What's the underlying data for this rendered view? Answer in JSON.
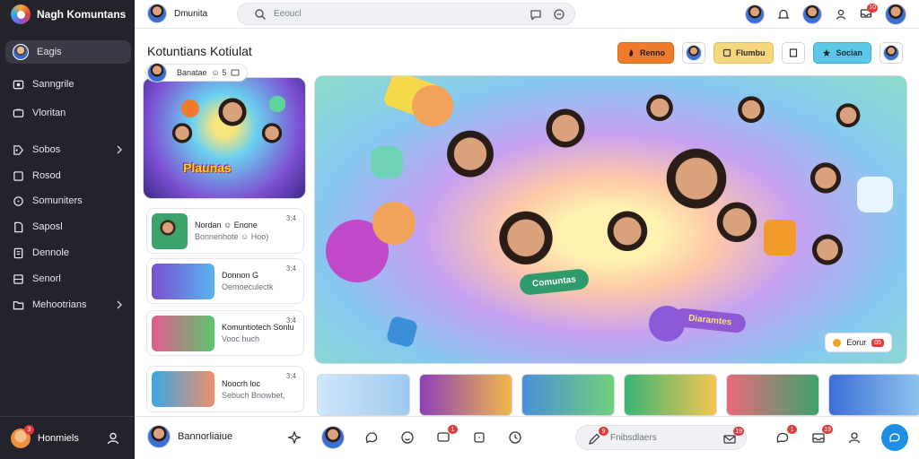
{
  "sidebar": {
    "brand": "Nagh Komuntans",
    "items": [
      {
        "label": "Eagis",
        "icon": "user-avatar-icon",
        "active": true
      },
      {
        "label": "Sanngrile",
        "icon": "home-icon"
      },
      {
        "label": "Vloritan",
        "icon": "tv-icon"
      },
      {
        "label": "Sobos",
        "icon": "tag-icon",
        "chevron": true
      },
      {
        "label": "Rosod",
        "icon": "square-icon"
      },
      {
        "label": "Somuniters",
        "icon": "circle-icon"
      },
      {
        "label": "Saposl",
        "icon": "document-icon"
      },
      {
        "label": "Dennole",
        "icon": "list-icon"
      },
      {
        "label": "Senorl",
        "icon": "grid-icon"
      },
      {
        "label": "Mehootrians",
        "icon": "folder-icon",
        "chevron": true
      }
    ],
    "footer": {
      "name": "Honmiels",
      "badge": "3"
    }
  },
  "topbar": {
    "user_name": "Dmunita",
    "search_placeholder": "Eeoucl",
    "notification_badge": "10"
  },
  "main": {
    "title": "Kotuntians Kotiulat",
    "chip": {
      "text": "Banatae",
      "extra": "☺ 5"
    },
    "buttons": {
      "orange": "Renno",
      "yellow": "Flumbu",
      "blue": "Socian"
    },
    "feature_card_title": "Plaunas",
    "list": [
      {
        "title": "Nordan ☺ Enone",
        "subtitle": "Bonnenhote ☺ Hoo)",
        "meta": "3:4"
      },
      {
        "title": "Donnon G",
        "subtitle": "Oemoeculectk",
        "meta": "3:4"
      },
      {
        "title": "Komuntiotech Sonlu",
        "subtitle": "Vooc huch",
        "meta": "3:4"
      },
      {
        "title": "Noocrh loc",
        "subtitle": "Sebuch Bnowbet,",
        "meta": "3:4"
      }
    ],
    "hero": {
      "banner_left": "Comuntas",
      "banner_right": "Diaramtes",
      "tag_text": "Eorur",
      "tag_badge": "05"
    }
  },
  "bottombar": {
    "user_name": "Bannorliaiue",
    "message_placeholder": "Fnibsdlaers",
    "badges": {
      "chat": "1",
      "message": "9",
      "mail": "19",
      "tray": "19"
    }
  },
  "colors": {
    "accent_blue": "#1c8ee6",
    "badge_red": "#e23b3b",
    "sidebar_bg": "#23232b"
  }
}
